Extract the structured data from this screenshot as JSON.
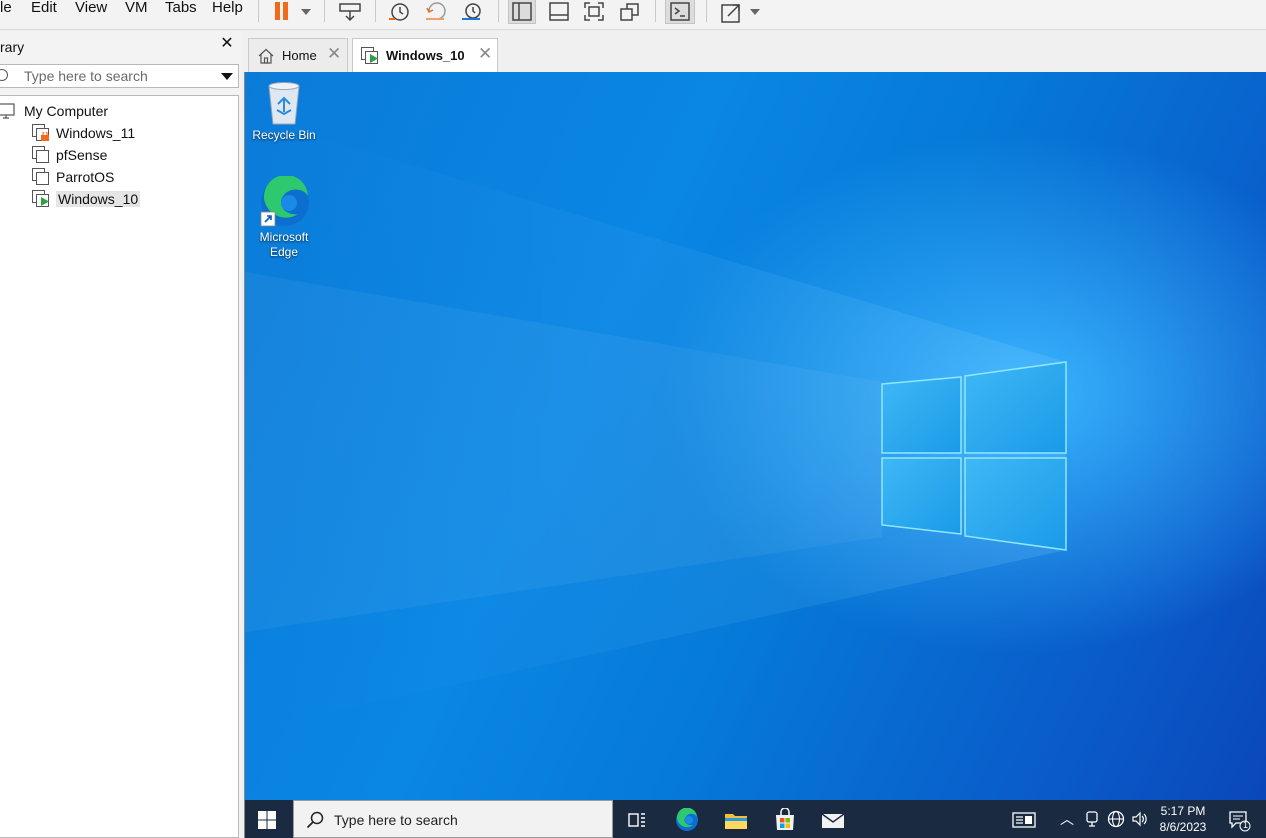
{
  "menu": {
    "items": [
      {
        "label": "le"
      },
      {
        "label": "Edit"
      },
      {
        "label": "View"
      },
      {
        "label": "VM"
      },
      {
        "label": "Tabs"
      },
      {
        "label": "Help"
      }
    ]
  },
  "toolbar": {
    "icons": [
      "pause-icon",
      "dropdown-arrow-icon",
      "send-ctrl-alt-del-icon",
      "snapshot-icon",
      "revert-snapshot-icon",
      "snapshot-manager-icon",
      "show-library-icon",
      "show-thumbnail-bar-icon",
      "full-screen-icon",
      "unity-icon",
      "console-view-icon",
      "stretch-guest-icon",
      "dropdown-arrow-icon"
    ]
  },
  "library": {
    "title": "rary",
    "search_placeholder": "Type here to search",
    "root": "My Computer",
    "vms": [
      {
        "name": "Windows_11",
        "state": "locked"
      },
      {
        "name": "pfSense",
        "state": "off"
      },
      {
        "name": "ParrotOS",
        "state": "off"
      },
      {
        "name": "Windows_10",
        "state": "running"
      }
    ]
  },
  "tabs": [
    {
      "label": "Home"
    },
    {
      "label": "Windows_10"
    }
  ],
  "desktop": {
    "icons": [
      {
        "label": "Recycle Bin"
      },
      {
        "label_line1": "Microsoft",
        "label_line2": "Edge"
      }
    ]
  },
  "taskbar": {
    "search_placeholder": "Type here to search",
    "clock_time": "5:17 PM",
    "clock_date": "8/6/2023",
    "notification_count": "1",
    "tray_icons": [
      "chevron-up-icon",
      "meet-now-icon",
      "network-icon",
      "volume-icon"
    ]
  },
  "colors": {
    "pause_orange": "#f06a1c",
    "desktop_blue": "#0a7ee0",
    "taskbar": "#1a2a40",
    "running_green": "#2ea043"
  }
}
